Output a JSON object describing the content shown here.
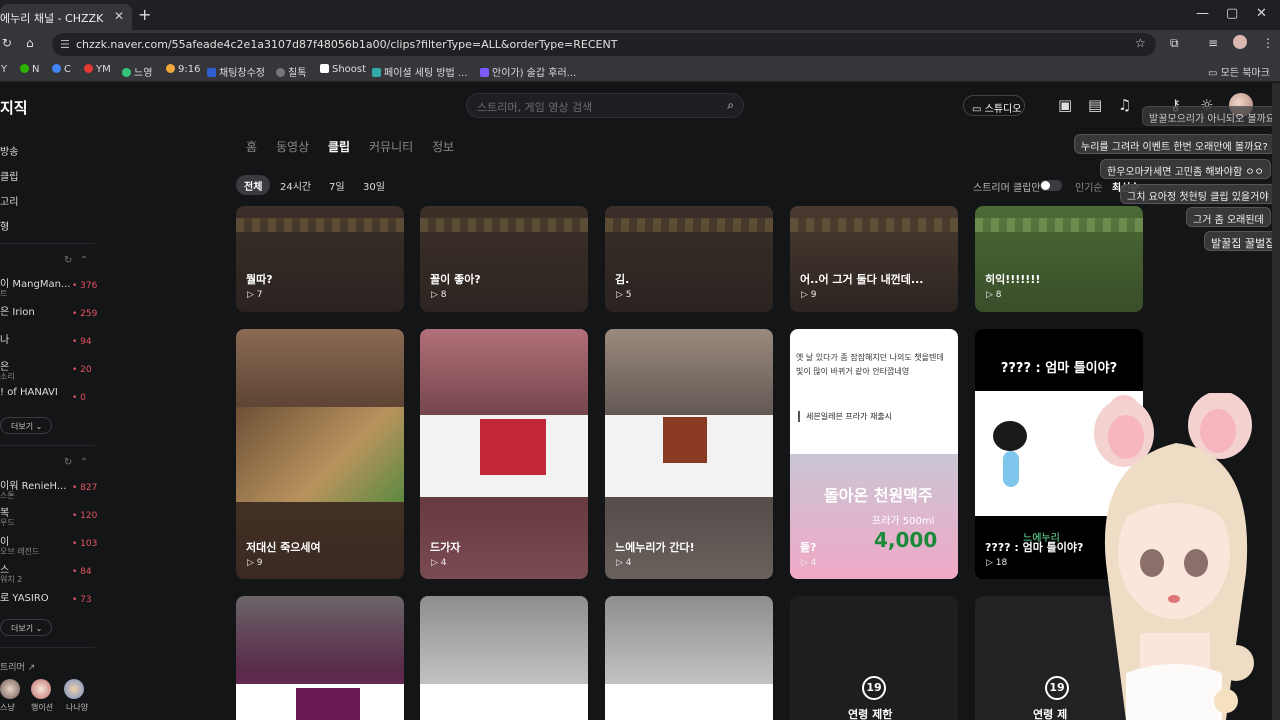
{
  "browser": {
    "tab_title": "에누리 채널 - CHZZK",
    "url": "chzzk.naver.com/55afeade4c2e1a3107d87f48056b1a00/clips?filterType=ALL&orderType=RECENT",
    "bookmarks": [
      "Y",
      "N",
      "C",
      "YM",
      "느영",
      "9:16",
      "채팅창수정",
      "칠톡",
      "Shoost",
      "페이셜 세팅 방법 ...",
      "안이가) 술갑 후러..."
    ],
    "bookmark_folder": "모든 북마크"
  },
  "site": {
    "logo": "지직",
    "search_placeholder": "스트리머, 게임 영상 검색",
    "studio_label": "스튜디오"
  },
  "sidebar": {
    "nav": [
      "방송",
      "클립",
      "고리",
      "형"
    ],
    "following": [
      {
        "name": "이 MangMan...",
        "sub": "트",
        "count": "376"
      },
      {
        "name": "은 Irion",
        "sub": "",
        "count": "259"
      },
      {
        "name": "나",
        "sub": "",
        "count": "94"
      },
      {
        "name": "은",
        "sub": "소리",
        "count": "20"
      },
      {
        "name": "! of HANAVI",
        "sub": "",
        "count": "0"
      }
    ],
    "more1": "더보기",
    "recommended": [
      {
        "name": "이워 RenieH...",
        "sub": "스톤",
        "count": "827"
      },
      {
        "name": "복",
        "sub": "우드",
        "count": "120"
      },
      {
        "name": "이",
        "sub": "오브 레전드",
        "count": "103"
      },
      {
        "name": "스",
        "sub": "워치 2",
        "count": "84"
      },
      {
        "name": "로 YASIRO",
        "sub": "",
        "count": "73"
      }
    ],
    "more2": "더보기",
    "partner_label": "트리머",
    "partner_names": [
      "스냥",
      "행이션",
      "나나양"
    ]
  },
  "channel_tabs": [
    "홈",
    "동영상",
    "클립",
    "커뮤니티",
    "정보"
  ],
  "active_tab": "클립",
  "filters": [
    "전체",
    "24시간",
    "7일",
    "30일"
  ],
  "toggle_label": "스트리머 클립만",
  "sort": [
    "인기순",
    "최신순"
  ],
  "clips_row1": [
    {
      "title": "뭘따?",
      "views": "7"
    },
    {
      "title": "꼴이 좋아?",
      "views": "8"
    },
    {
      "title": "김.",
      "views": "5"
    },
    {
      "title": "어..어 그거 둘다 내껀데...",
      "views": "9"
    },
    {
      "title": "히익!!!!!!!",
      "views": "8"
    }
  ],
  "clips_row2": [
    {
      "title": "저대신 죽으세여",
      "views": "9"
    },
    {
      "title": "드가자",
      "views": "4"
    },
    {
      "title": "느에누리가 간다!",
      "views": "4"
    },
    {
      "title": "들?",
      "views": "4"
    },
    {
      "title": "???? : 엄마 틀이야?",
      "views": "18"
    }
  ],
  "clip_texts": {
    "c2_3_caption": "옛 날 있다가 좀 잠잠해지던 나의도 챗을텐데\n빛이 많이 바뀌거 같아 안타깝네영",
    "c2_3_quote": "세븐일레븐 프라가 재출시",
    "c2_3_banner": "돌아온 천원맥주",
    "c2_3_sub": "프라가 500ml",
    "c2_3_price": "4,000",
    "c2_4_banner": "???? : 엄마 틀이야?",
    "c2_4_overlay": "느에누리"
  },
  "age_restricted": [
    {
      "label": "연령 제한",
      "badge": "19"
    },
    {
      "label": "연령 제",
      "badge": "19"
    }
  ],
  "chat_messages": [
    "발꿀모으리가 아니되오 볼까요?",
    "누리를 그려라 이벤트 한번 오래만에 볼까요?",
    "한우오마카세면 고민좀 해봐야함 ㅇㅇ",
    "그치 요아정 첫현팅 클립 있을거야",
    "그거 좀 오래된데",
    "발꿀집 꿀벌집"
  ]
}
